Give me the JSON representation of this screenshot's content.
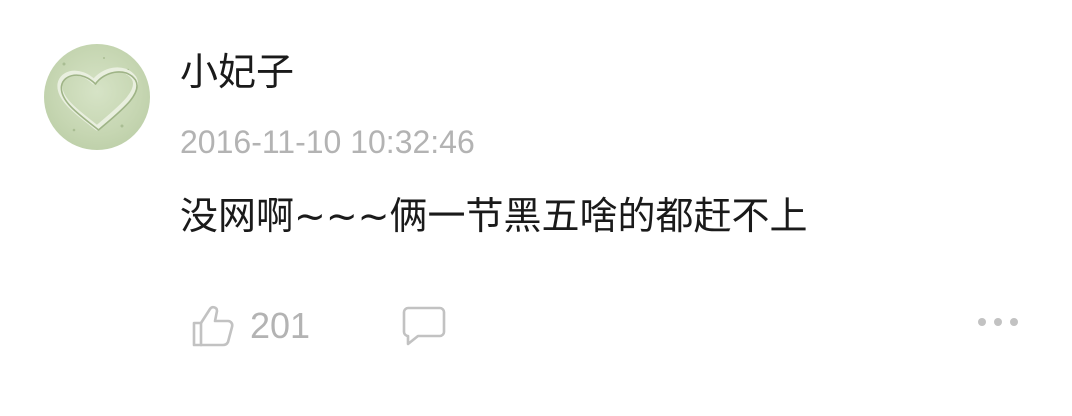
{
  "comment": {
    "avatar_icon": "heart-in-sand-avatar",
    "username": "小妃子",
    "timestamp": "2016-11-10 10:32:46",
    "text": "没网啊~~~俩一节黑五啥的都赶不上"
  },
  "actions": {
    "like_icon": "thumbs-up-icon",
    "like_count": "201",
    "reply_icon": "chat-bubble-icon",
    "more_icon": "more-dots-icon"
  },
  "colors": {
    "text_primary": "#1a1a1a",
    "text_secondary": "#b3b3b3",
    "icon_gray": "#c2c2c2",
    "background": "#ffffff"
  }
}
